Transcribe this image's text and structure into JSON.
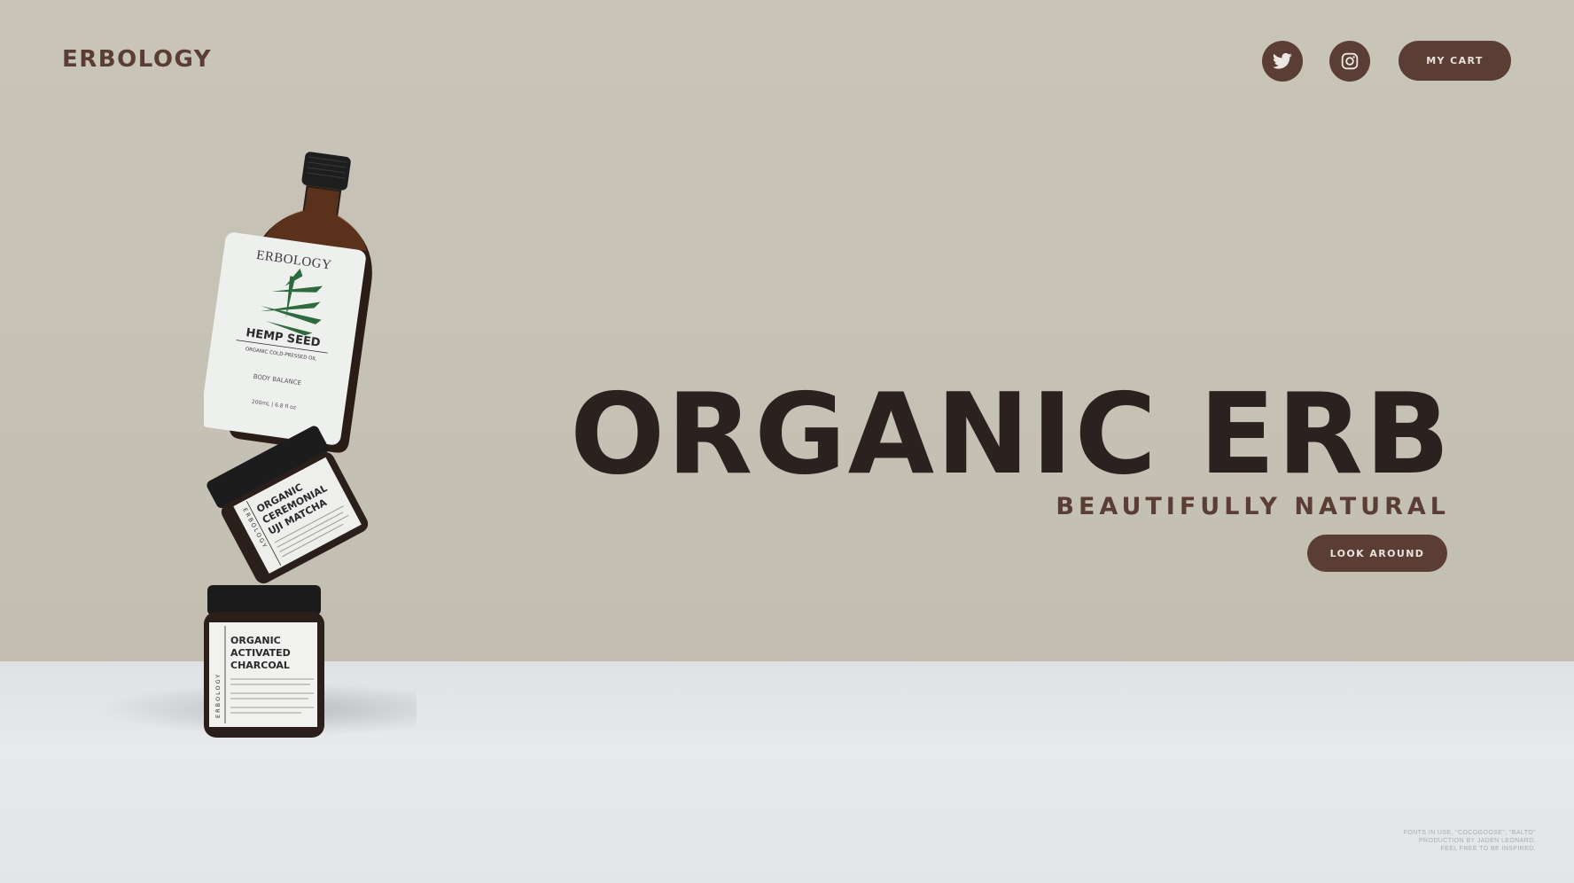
{
  "header": {
    "brand": "ERBOLOGY",
    "cart_label": "MY CART",
    "social": [
      {
        "icon": "twitter-icon"
      },
      {
        "icon": "instagram-icon"
      }
    ]
  },
  "hero": {
    "title": "ORGANIC ERB",
    "subtitle": "BEAUTIFULLY NATURAL",
    "cta_label": "LOOK AROUND"
  },
  "products": {
    "bottle": {
      "brand": "ERBOLOGY",
      "name": "HEMP SEED",
      "descriptor": "ORGANIC COLD-PRESSED OIL",
      "line": "BODY BALANCE",
      "volume": "200mL  |  6.8 fl oz"
    },
    "jar_middle": {
      "brand": "ERBOLOGY",
      "name_lines": [
        "ORGANIC",
        "CEREMONIAL",
        "UJI MATCHA"
      ]
    },
    "jar_bottom": {
      "brand": "ERBOLOGY",
      "name_lines": [
        "ORGANIC",
        "ACTIVATED",
        "CHARCOAL"
      ]
    }
  },
  "credits": {
    "lines": [
      "FONTS IN USE, \"COCOGOOSE\", \"BALTO\"",
      "PRODUCTION BY JADEN LEONARD.",
      "FEEL FREE TO BE INSPIRED."
    ]
  },
  "colors": {
    "wall": "#c8c3b8",
    "floor": "#e3e6e9",
    "accent": "#5a3d35",
    "title": "#2b2220"
  }
}
